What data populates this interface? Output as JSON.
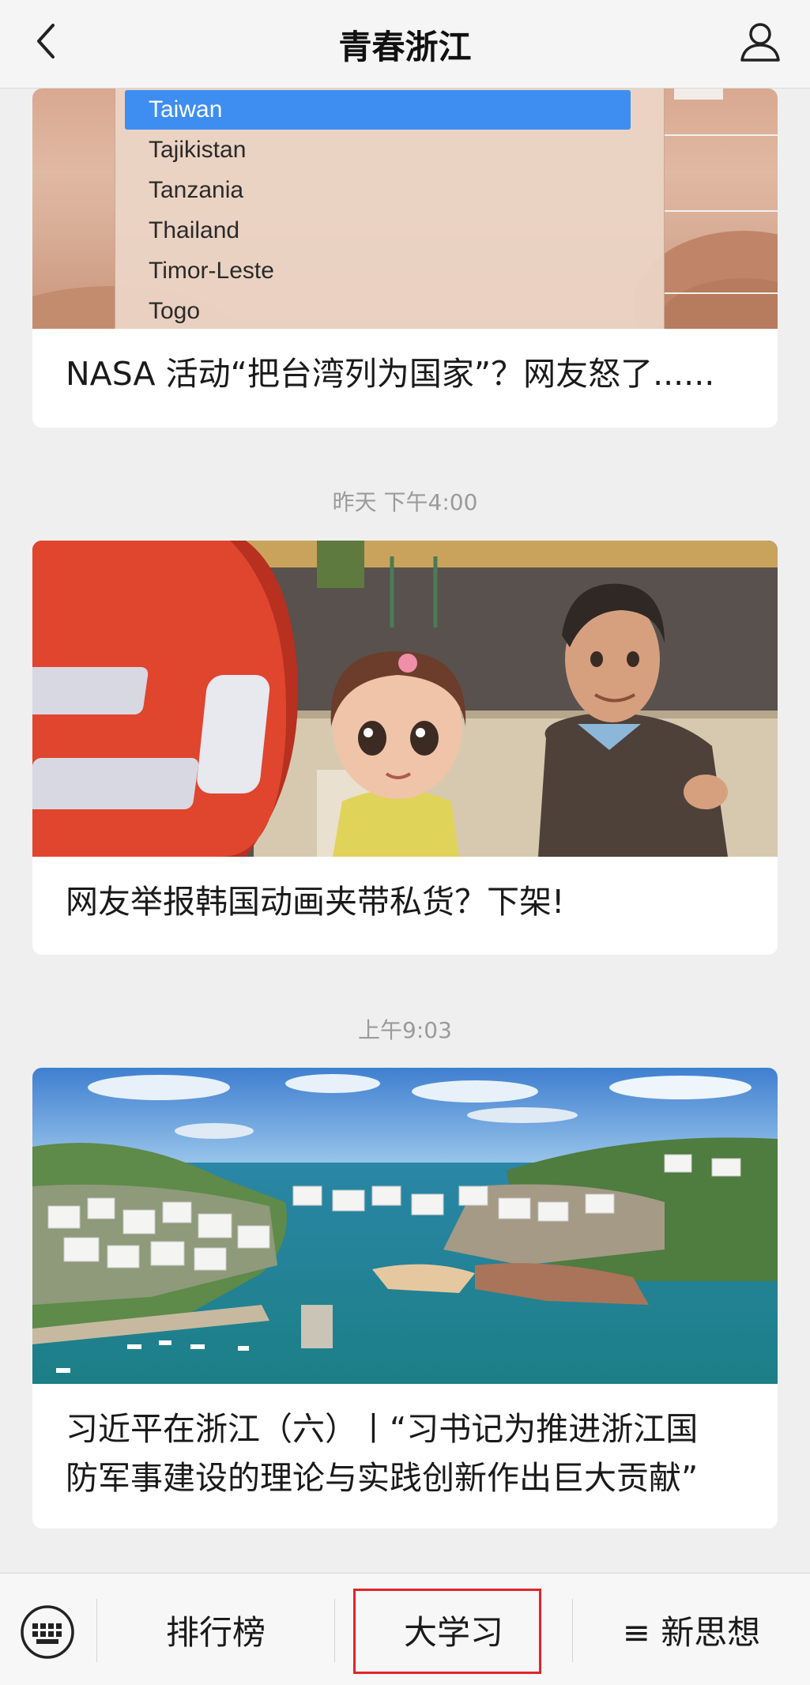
{
  "nav": {
    "title": "青春浙江",
    "back_icon": "chevron-left-icon",
    "profile_icon": "user-icon"
  },
  "messages": [
    {
      "image_alt": "country dropdown list over desert background",
      "dropdown_options": [
        "Taiwan",
        "Tajikistan",
        "Tanzania",
        "Thailand",
        "Timor-Leste",
        "Togo"
      ],
      "selected_option": "Taiwan",
      "title": "NASA 活动“把台湾列为国家”？网友怒了......"
    },
    {
      "timestamp": "昨天 下午4:00",
      "image_alt": "cartoon girl and man",
      "title": "网友举报韩国动画夹带私货？下架!"
    },
    {
      "timestamp": "上午9:03",
      "image_alt": "aerial view of island harbour village",
      "title_line1": "习近平在浙江（六）丨“习书记为推进浙江国",
      "title_line2": "防军事建设的理论与实践创新作出巨大贡献”"
    }
  ],
  "bottom_menu": {
    "keyboard_icon": "keyboard-icon",
    "items": [
      {
        "label": "排行榜"
      },
      {
        "label": "大学习",
        "highlighted": true
      },
      {
        "label": "≡ 新思想"
      }
    ]
  },
  "colors": {
    "selected_option": "#3d8ef0",
    "highlight_border": "#e3242b",
    "background": "#efefef"
  }
}
